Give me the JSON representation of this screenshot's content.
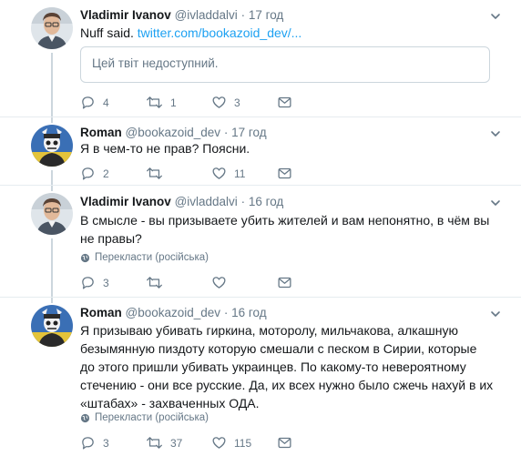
{
  "tweets": [
    {
      "name": "Vladimir Ivanov",
      "handle": "@ivladdalvi",
      "time": "17 год",
      "text": "Nuff said. ",
      "link": "twitter.com/bookazoid_dev/...",
      "quote": "Цей твіт недоступний.",
      "replies": "4",
      "retweets": "1",
      "likes": "3",
      "avatar_icon": "person-avatar"
    },
    {
      "name": "Roman",
      "handle": "@bookazoid_dev",
      "time": "17 год",
      "text": "Я в чем-то не прав? Поясни.",
      "replies": "2",
      "retweets": "",
      "likes": "11",
      "avatar_icon": "skeleton-soldier-avatar"
    },
    {
      "name": "Vladimir Ivanov",
      "handle": "@ivladdalvi",
      "time": "16 год",
      "text": "В смысле - вы призываете убить жителей и вам непонятно, в чём вы не правы?",
      "translate": "Перекласти (російська)",
      "replies": "3",
      "retweets": "",
      "likes": "",
      "avatar_icon": "person-avatar"
    },
    {
      "name": "Roman",
      "handle": "@bookazoid_dev",
      "time": "16 год",
      "text": "Я призываю убивать гиркина, моторолу, мильчакова, алкашную безымянную пиздоту которую смешали с песком в Сирии, которые до этого пришли убивать украинцев. По какому-то невероятному стечению - они все русские. Да, их всех нужно было сжечь нахуй в их «штабах» - захваченных ОДА.",
      "translate": "Перекласти (російська)",
      "replies": "3",
      "retweets": "37",
      "likes": "115",
      "avatar_icon": "skeleton-soldier-avatar"
    }
  ],
  "separator": "·",
  "colors": {
    "text": "#14171a",
    "muted": "#657786",
    "link": "#1da1f2",
    "border": "#ccd6dd",
    "divider": "#e6ecf0"
  }
}
